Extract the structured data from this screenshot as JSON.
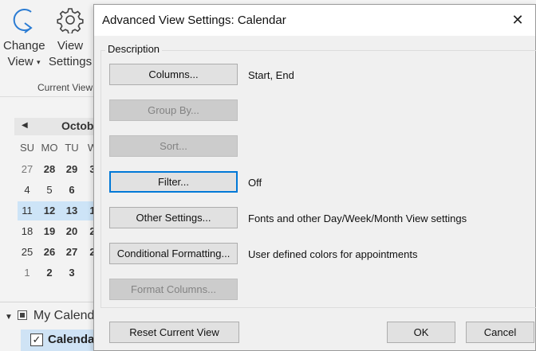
{
  "ribbon": {
    "change_view": {
      "line1": "Change",
      "line2": "View",
      "caret": "▾"
    },
    "view_settings": {
      "line1": "View",
      "line2": "Settings"
    },
    "group_label": "Current View"
  },
  "calendar": {
    "month": "October",
    "days_of_week": [
      "SU",
      "MO",
      "TU",
      "W"
    ],
    "weeks": [
      [
        "27",
        "28",
        "29",
        "3"
      ],
      [
        "4",
        "5",
        "6",
        ""
      ],
      [
        "11",
        "12",
        "13",
        "1"
      ],
      [
        "18",
        "19",
        "20",
        "2"
      ],
      [
        "25",
        "26",
        "27",
        "2"
      ],
      [
        "1",
        "2",
        "3",
        ""
      ]
    ],
    "folder_group": "My Calendars",
    "folder_item": "Calendar"
  },
  "dialog": {
    "title": "Advanced View Settings: Calendar",
    "close_glyph": "✕",
    "group_label": "Description",
    "rows": [
      {
        "button": "Columns...",
        "description": "Start, End"
      },
      {
        "button": "Group By...",
        "description": ""
      },
      {
        "button": "Sort...",
        "description": ""
      },
      {
        "button": "Filter...",
        "description": "Off"
      },
      {
        "button": "Other Settings...",
        "description": "Fonts and other Day/Week/Month View settings"
      },
      {
        "button": "Conditional Formatting...",
        "description": "User defined colors for appointments"
      },
      {
        "button": "Format Columns...",
        "description": ""
      }
    ],
    "reset_button": "Reset Current View",
    "ok_button": "OK",
    "cancel_button": "Cancel"
  },
  "colors": {
    "accent": "#0078d7",
    "selection": "#cde4f7",
    "dialog_bg": "#f0f0f0",
    "icon_blue": "#2b7cd3"
  }
}
